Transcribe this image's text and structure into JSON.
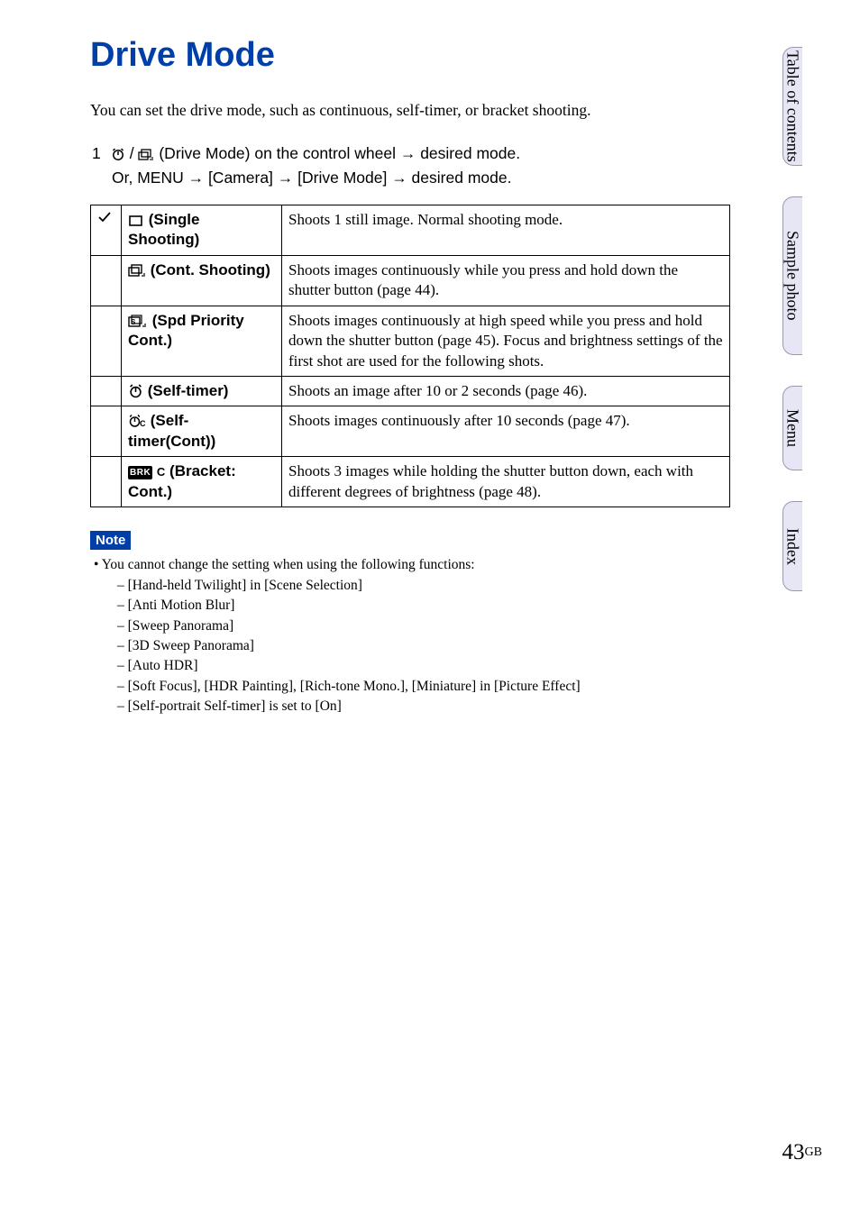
{
  "title": "Drive Mode",
  "intro": "You can set the drive mode, such as continuous, self-timer, or bracket shooting.",
  "step": {
    "num": "1",
    "line1_pre": "",
    "line1_post": " (Drive Mode) on the control wheel → desired mode.",
    "line2": "Or, MENU → [Camera] → [Drive Mode] → desired mode."
  },
  "table": {
    "rows": [
      {
        "check": true,
        "icon": "single",
        "label": "(Single Shooting)",
        "desc": "Shoots 1 still image. Normal shooting mode."
      },
      {
        "check": false,
        "icon": "cont",
        "label": "(Cont. Shooting)",
        "desc": "Shoots images continuously while you press and hold down the shutter button (page 44)."
      },
      {
        "check": false,
        "icon": "speed",
        "label": "(Spd Priority Cont.)",
        "desc": "Shoots images continuously at high speed while you press and hold down the shutter button (page 45). Focus and brightness settings of the first shot are used for the following shots."
      },
      {
        "check": false,
        "icon": "selftimer",
        "label": "(Self-timer)",
        "desc": "Shoots an image after 10 or 2 seconds (page 46)."
      },
      {
        "check": false,
        "icon": "selftimer-c",
        "label": "(Self-timer(Cont))",
        "desc": "Shoots images continuously after 10 seconds (page 47)."
      },
      {
        "check": false,
        "icon": "bracket",
        "label": "(Bracket: Cont.)",
        "desc": "Shoots 3 images while holding the shutter button down, each with different degrees of brightness (page 48)."
      }
    ]
  },
  "note": {
    "label": "Note",
    "bullet": "You cannot change the setting when using the following functions:",
    "items": [
      "[Hand-held Twilight] in [Scene Selection]",
      "[Anti Motion Blur]",
      "[Sweep Panorama]",
      "[3D Sweep Panorama]",
      "[Auto HDR]",
      "[Soft Focus], [HDR Painting], [Rich-tone Mono.], [Miniature] in [Picture Effect]",
      "[Self-portrait Self-timer] is set to [On]"
    ]
  },
  "tabs": {
    "toc": "Table of contents",
    "sample": "Sample photo",
    "menu": "Menu",
    "index": "Index"
  },
  "page": {
    "num": "43",
    "region": "GB"
  }
}
